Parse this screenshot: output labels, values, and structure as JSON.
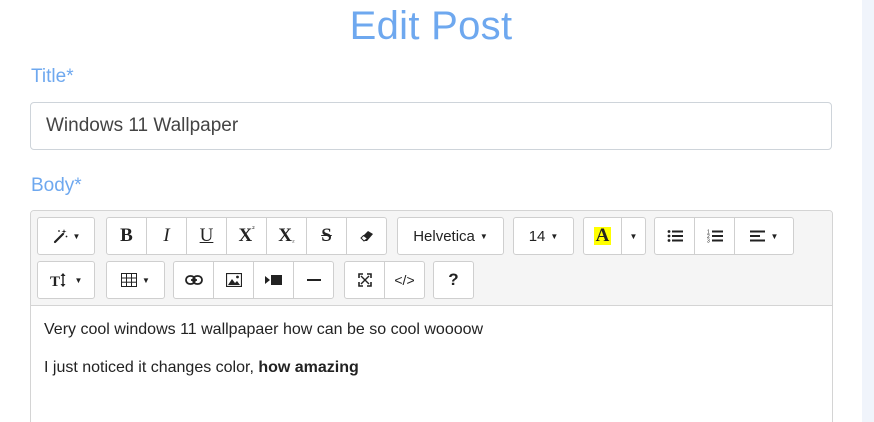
{
  "page": {
    "title": "Edit Post"
  },
  "form": {
    "title_label": "Title*",
    "title_value": "Windows 11 Wallpaper",
    "body_label": "Body*"
  },
  "editor": {
    "toolbar": {
      "style_icon": "magic-wand-icon",
      "bold": "B",
      "italic": "I",
      "underline": "U",
      "superscript": "X",
      "superscript_mark": "²",
      "subscript": "X",
      "subscript_mark": "₂",
      "strikethrough": "S",
      "clear_format_icon": "eraser-icon",
      "font_name": "Helvetica",
      "font_size": "14",
      "forecolor": "A",
      "forecolor_highlight": "#ffff00",
      "unordered_list_icon": "bulleted-list-icon",
      "ordered_list_icon": "numbered-list-icon",
      "paragraph_icon": "align-left-icon",
      "line_height_icon": "text-height-icon",
      "table_icon": "table-icon",
      "link_icon": "link-icon",
      "picture_icon": "image-icon",
      "video_icon": "video-icon",
      "hr_icon": "horizontal-rule-icon",
      "fullscreen_icon": "fullscreen-icon",
      "codeview": "</>",
      "help": "?"
    },
    "content": {
      "paragraph1": "Very cool windows 11 wallpapaer how can be so cool woooow",
      "paragraph2_text": "I just noticed it changes color, ",
      "paragraph2_bold": "how amazing"
    }
  }
}
